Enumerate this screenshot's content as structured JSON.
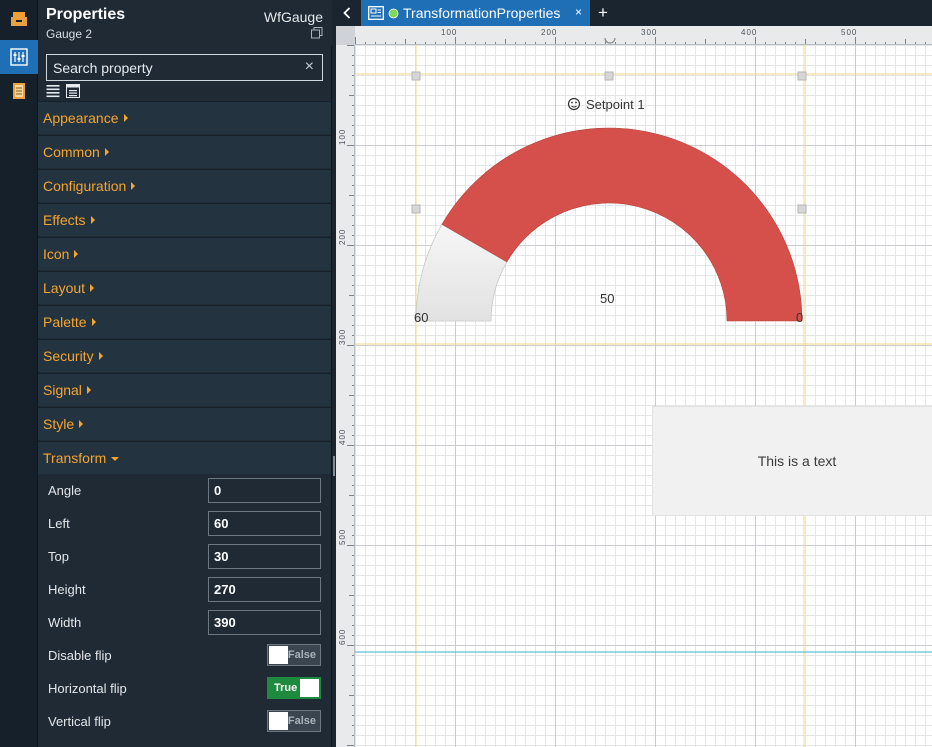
{
  "panel": {
    "title": "Properties",
    "widget_type": "WfGauge",
    "widget_name": "Gauge 2",
    "search_placeholder": "Search property",
    "search_clear": "×"
  },
  "categories": [
    {
      "label": "Appearance",
      "expanded": false
    },
    {
      "label": "Common",
      "expanded": false
    },
    {
      "label": "Configuration",
      "expanded": false
    },
    {
      "label": "Effects",
      "expanded": false
    },
    {
      "label": "Icon",
      "expanded": false
    },
    {
      "label": "Layout",
      "expanded": false
    },
    {
      "label": "Palette",
      "expanded": false
    },
    {
      "label": "Security",
      "expanded": false
    },
    {
      "label": "Signal",
      "expanded": false
    },
    {
      "label": "Style",
      "expanded": false
    },
    {
      "label": "Transform",
      "expanded": true
    }
  ],
  "transform": {
    "fields": [
      {
        "label": "Angle",
        "value": "0"
      },
      {
        "label": "Left",
        "value": "60"
      },
      {
        "label": "Top",
        "value": "30"
      },
      {
        "label": "Height",
        "value": "270"
      },
      {
        "label": "Width",
        "value": "390"
      }
    ],
    "toggles": [
      {
        "label": "Disable flip",
        "state": "False",
        "on": false
      },
      {
        "label": "Horizontal flip",
        "state": "True",
        "on": true
      },
      {
        "label": "Vertical flip",
        "state": "False",
        "on": false
      }
    ]
  },
  "tab": {
    "label": "TransformationProperties",
    "close": "×",
    "add": "+",
    "status_color": "#7ed957"
  },
  "ruler": {
    "h_labels": [
      "100",
      "200",
      "300",
      "400",
      "500"
    ],
    "v_labels": [
      "100",
      "200",
      "300",
      "400",
      "500",
      "600"
    ]
  },
  "gauge": {
    "setpoint_label": "Setpoint 1",
    "value_label": "50",
    "min_label": "60",
    "max_label": "0",
    "bar_color": "#d5504a",
    "track_color": "#eeeeee",
    "fill_fraction": 0.833
  },
  "text_widget": {
    "text": "This is a text"
  },
  "colors": {
    "accent": "#1e6fb5",
    "category_text": "#f4a531",
    "toggle_on": "#1e8a3e",
    "guide_line": "#f0d98a",
    "cyan_guide": "#36b6c9"
  }
}
